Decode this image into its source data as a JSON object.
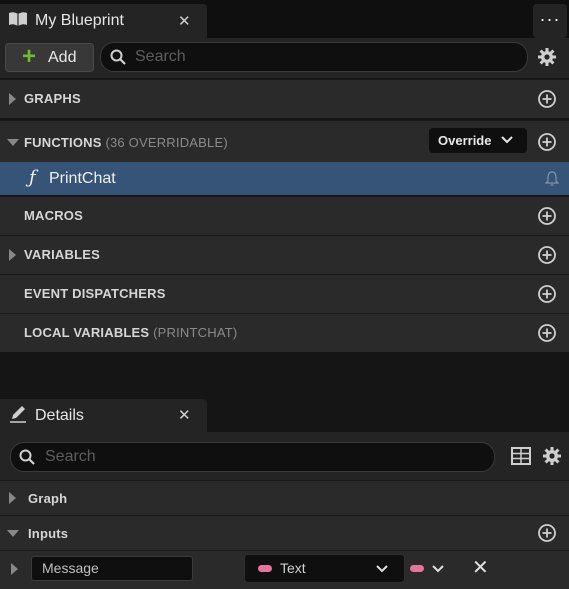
{
  "blueprint_tab": {
    "title": "My Blueprint",
    "close": "✕",
    "icon": "book-icon"
  },
  "menu_button": {
    "label": "···"
  },
  "toolbar": {
    "add_label": "Add",
    "search_placeholder": "Search"
  },
  "sections": {
    "graphs": "GRAPHS",
    "functions": {
      "label": "FUNCTIONS",
      "count": "(36 OVERRIDABLE)",
      "override_label": "Override"
    },
    "function_item": {
      "icon": "ƒ",
      "name": "PrintChat"
    },
    "macros": "MACROS",
    "variables": "VARIABLES",
    "event_dispatchers": "EVENT DISPATCHERS",
    "local_variables": {
      "label": "LOCAL VARIABLES",
      "scope": "(PRINTCHAT)"
    }
  },
  "details_tab": {
    "title": "Details",
    "close": "✕",
    "icon": "pencil-icon"
  },
  "details": {
    "search_placeholder": "Search",
    "graph_label": "Graph",
    "inputs_label": "Inputs",
    "input_row": {
      "name": "Message",
      "type": "Text",
      "remove": "✕"
    }
  },
  "colors": {
    "accent_selected": "#365477",
    "add_plus": "#6dbd2c",
    "text_pin": "#e7739c"
  }
}
